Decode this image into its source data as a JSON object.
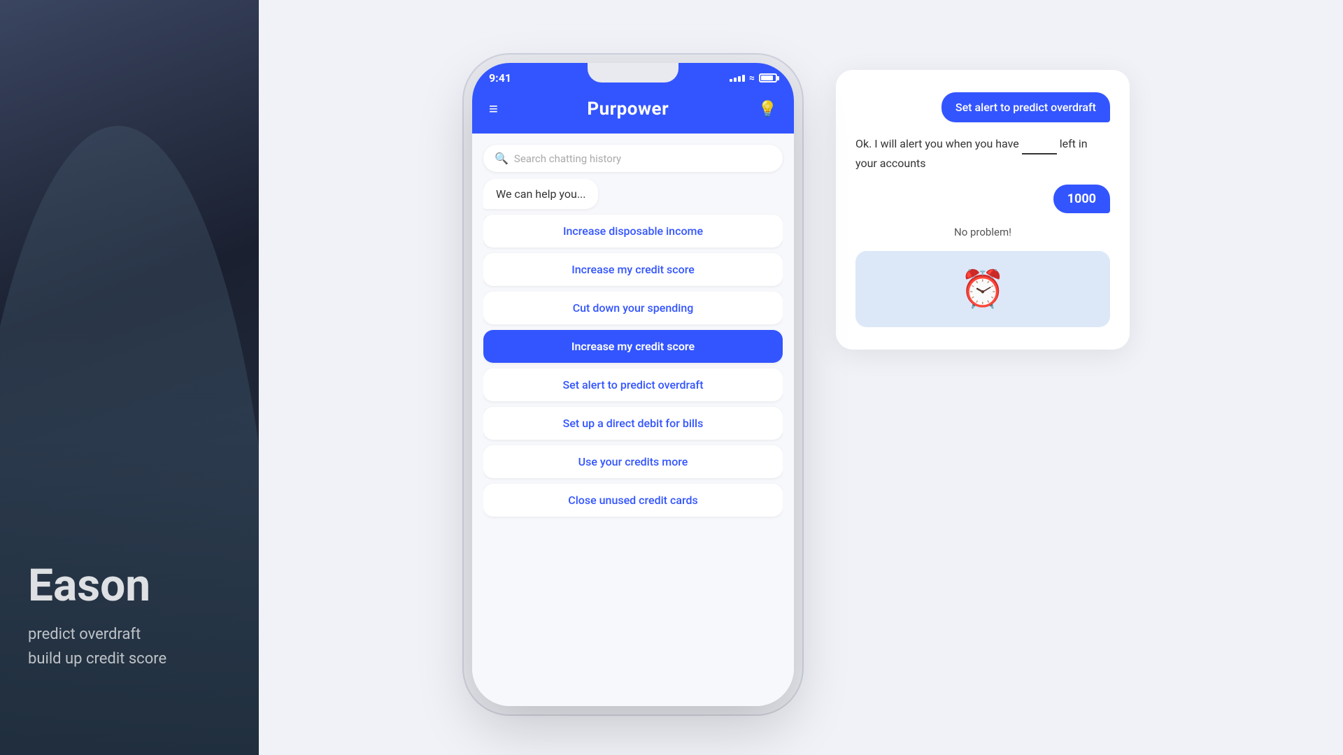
{
  "leftPanel": {
    "name": "Eason",
    "subtitle_line1": "predict overdraft",
    "subtitle_line2": "build up credit score"
  },
  "phone": {
    "statusBar": {
      "time": "9:41",
      "signalBars": [
        3,
        5,
        7,
        9,
        11
      ],
      "wifi": "wifi",
      "battery": "battery"
    },
    "header": {
      "hamburger": "≡",
      "title": "Purpower",
      "lightbulb": "💡"
    },
    "search": {
      "placeholder": "Search chatting history"
    },
    "helperText": "We can help you...",
    "menuItems": [
      {
        "label": "Increase disposable income",
        "selected": false
      },
      {
        "label": "Increase my credit score",
        "selected": false
      },
      {
        "label": "Cut down your spending",
        "selected": false
      },
      {
        "label": "Increase my credit score",
        "selected": true
      },
      {
        "label": "Set alert to predict overdraft",
        "selected": false
      },
      {
        "label": "Set up a direct debit for bills",
        "selected": false
      },
      {
        "label": "Use your credits more",
        "selected": false
      },
      {
        "label": "Close unused credit cards",
        "selected": false
      }
    ]
  },
  "chatCard": {
    "userMessage": "Set alert to predict overdraft",
    "botResponse": "Ok. I will alert you when you have ______ left in your accounts",
    "userAmount": "1000",
    "noProblem": "No problem!",
    "alarmEmoji": "⏰"
  },
  "colors": {
    "primary": "#3355ff",
    "background": "#f0f2f8",
    "cardBg": "#ffffff"
  }
}
